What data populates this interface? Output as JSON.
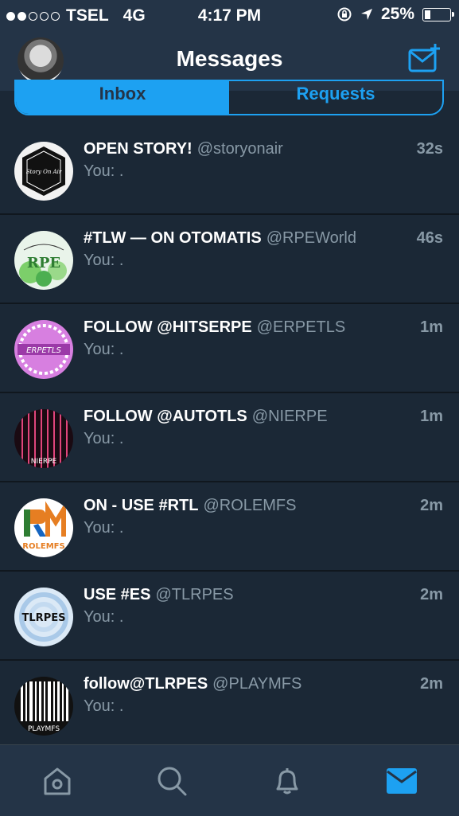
{
  "status": {
    "carrier": "TSEL",
    "network": "4G",
    "time": "4:17 PM",
    "battery": "25%",
    "battery_level": 0.25,
    "signal_strength_dots": 2
  },
  "header": {
    "title": "Messages"
  },
  "segments": {
    "inbox": "Inbox",
    "requests": "Requests",
    "active": "inbox"
  },
  "conversations": [
    {
      "name": "OPEN STORY!",
      "handle": "@storyonair",
      "time": "32s",
      "preview": "You: .",
      "avatar_icon": "story-on-air-logo",
      "avatar_text": "Story On Air"
    },
    {
      "name": "#TLW — ON OTOMATIS",
      "handle": "@RPEWorld",
      "time": "46s",
      "preview": "You: .",
      "avatar_icon": "rpe-world-logo",
      "avatar_text": "RPE"
    },
    {
      "name": "FOLLOW @HITSERPE",
      "handle": "@ERPETLS",
      "time": "1m",
      "preview": "You: .",
      "avatar_icon": "erpetls-logo",
      "avatar_text": "ERPETLS"
    },
    {
      "name": "FOLLOW @AUTOTLS",
      "handle": "@NIERPE",
      "time": "1m",
      "preview": "You: .",
      "avatar_icon": "nierpe-logo",
      "avatar_text": "NIERPE"
    },
    {
      "name": "ON - USE #RTL",
      "handle": "@ROLEMFS",
      "time": "2m",
      "preview": "You: .",
      "avatar_icon": "rolemfs-logo",
      "avatar_text": "ROLEMFS"
    },
    {
      "name": "USE #ES",
      "handle": "@TLRPES",
      "time": "2m",
      "preview": "You: .",
      "avatar_icon": "tlrpes-logo",
      "avatar_text": "TLRPES"
    },
    {
      "name": "follow@TLRPES",
      "handle": "@PLAYMFS",
      "time": "2m",
      "preview": "You: .",
      "avatar_icon": "playmfs-logo",
      "avatar_text": "PLAYMFS"
    }
  ],
  "tabbar": {
    "items": [
      "home-icon",
      "search-icon",
      "notifications-bell-icon",
      "messages-envelope-icon"
    ],
    "active": "messages-envelope-icon"
  },
  "colors": {
    "accent": "#1da1f2",
    "background": "#1b2836",
    "bar": "#243447",
    "muted": "#8899a6"
  }
}
